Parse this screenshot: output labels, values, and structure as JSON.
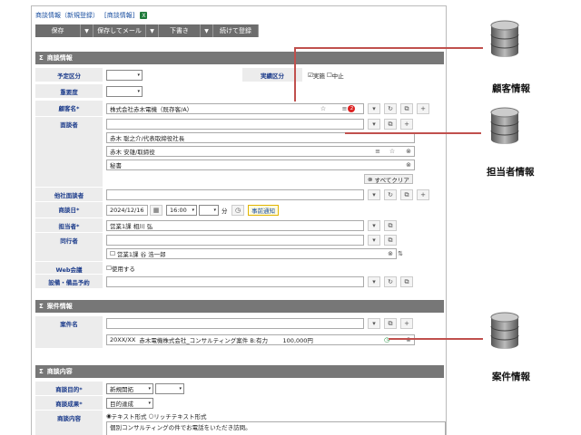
{
  "title": {
    "main": "商談情報（新規登録）",
    "sub": "[商談情報]",
    "xl": "X"
  },
  "toolbar": {
    "save": "保存",
    "save_mail": "保存してメール",
    "draft": "下書き",
    "continue": "続けて登録",
    "arrow": "▼"
  },
  "sections": {
    "deal": "商談情報",
    "case": "案件情報",
    "content": "商談内容",
    "sigma": "Σ"
  },
  "fields": {
    "plan_type": {
      "label": "予定区分",
      "value": ""
    },
    "actual_type": {
      "label": "実績区分",
      "opt1": "実施",
      "opt2": "中止"
    },
    "importance": {
      "label": "重要度",
      "value": ""
    },
    "customer": {
      "label": "顧客名*",
      "value": "株式会社赤木電機（既存客/A）",
      "badge": "2"
    },
    "contacts": {
      "label": "面談者",
      "items": [
        "赤木 聡之介/代表取締役社長",
        "赤木 安雄/取締役",
        "秘書"
      ],
      "clear": "すべてクリア"
    },
    "our_attendee": {
      "label": "他社面談者"
    },
    "date": {
      "label": "商談日*",
      "date": "2024/12/16",
      "time": "16:00",
      "min_unit": "分",
      "notify": "事前通知"
    },
    "owner": {
      "label": "担当者*",
      "value": "営業1課 相川 弘"
    },
    "companion": {
      "label": "同行者",
      "value": "営業1課 谷 浩一郎"
    },
    "web_meeting": {
      "label": "Web会議",
      "value": "使用する"
    },
    "equipment": {
      "label": "設備・備品予約"
    },
    "case_name": {
      "label": "案件名",
      "code": "20XX/XX",
      "value": "赤木電機株式会社_コンサルティング案件 B:有力",
      "amount": "100,000円"
    },
    "purpose": {
      "label": "商談目的*",
      "value": "新規開拓"
    },
    "result": {
      "label": "商談成果*",
      "value": "目的達成"
    },
    "content": {
      "label": "商談内容",
      "fmt1": "テキスト形式",
      "fmt2": "リッチテキスト形式",
      "text": "個別コンサルティングの件でお電話をいただき訪問。"
    }
  },
  "callouts": {
    "customer": "顧客情報",
    "contact": "担当者情報",
    "case": "案件情報"
  },
  "icons": {
    "dropdown": "▾",
    "refresh": "↻",
    "copy": "⧉",
    "add": "+",
    "star": "☆",
    "list": "≡",
    "close": "⊗",
    "calendar": "▦",
    "clock": "◷",
    "updown": "⇅"
  },
  "colors": {
    "accent_line": "#c0504d",
    "section_bg": "#777777",
    "label_fg": "#1a3a8a"
  }
}
